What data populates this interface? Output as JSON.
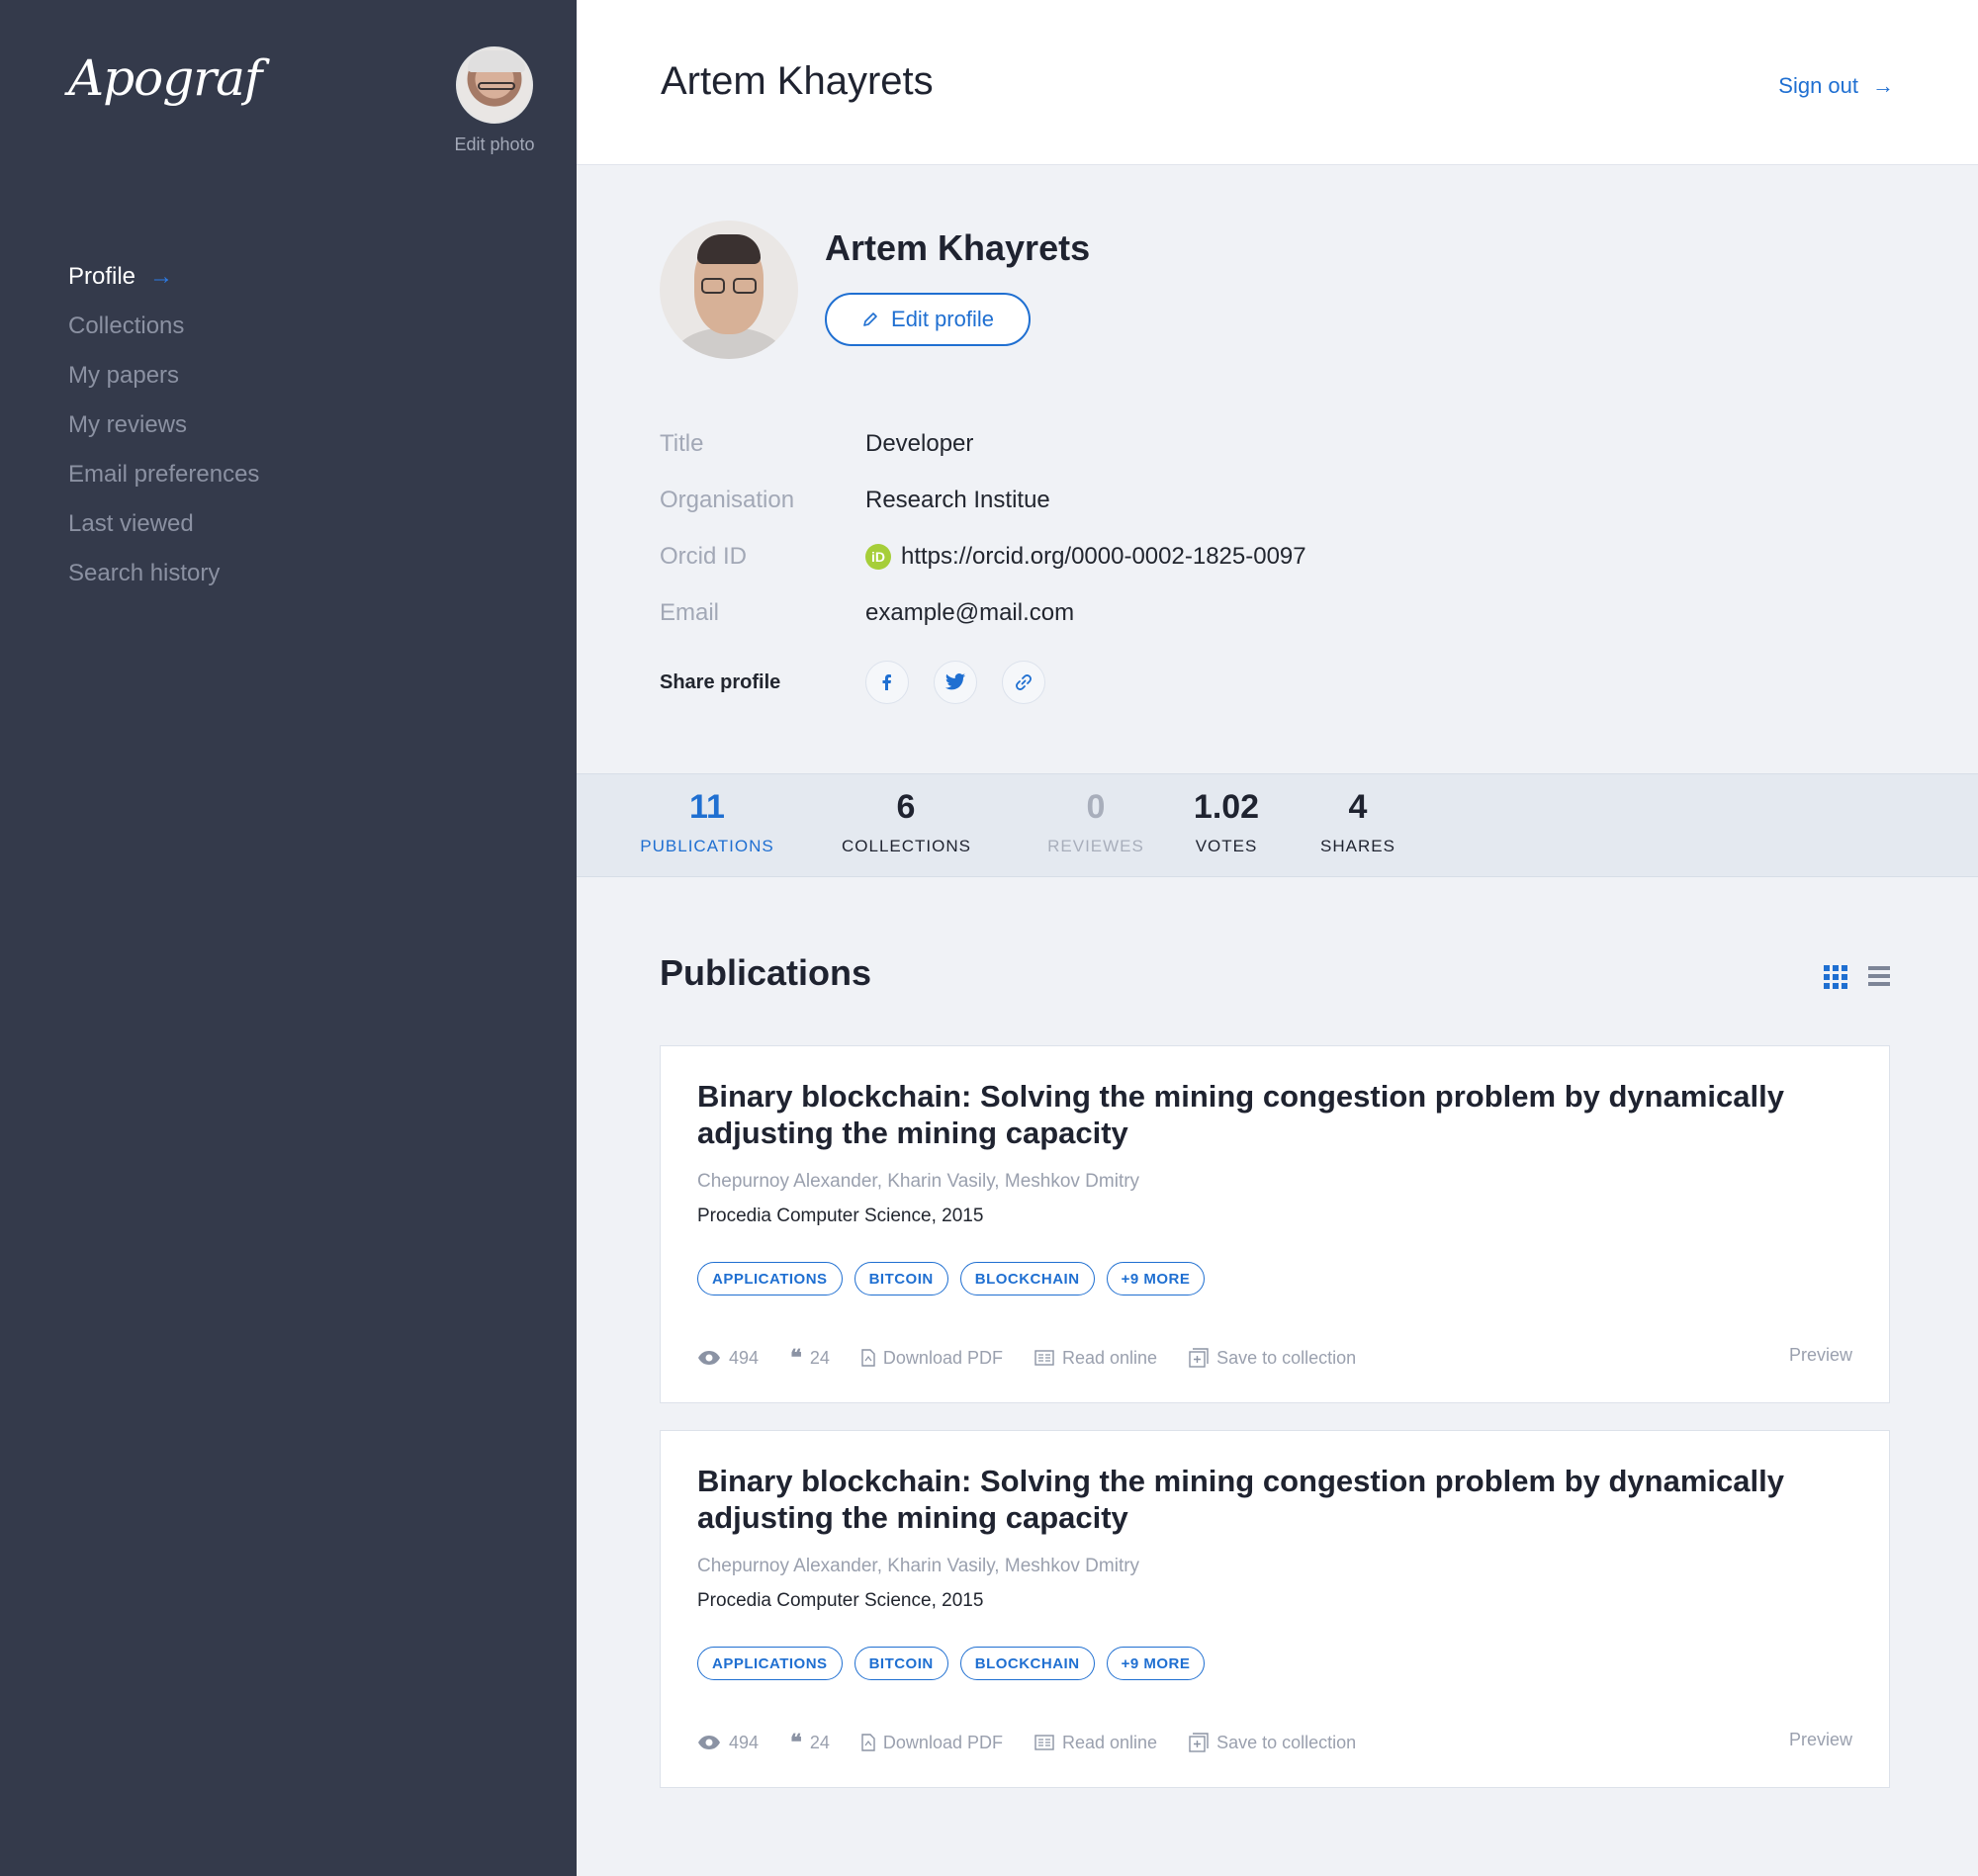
{
  "sidebar": {
    "logo": "Apograf",
    "edit_photo": "Edit photo",
    "nav": [
      {
        "label": "Profile"
      },
      {
        "label": "Collections"
      },
      {
        "label": "My papers"
      },
      {
        "label": "My reviews"
      },
      {
        "label": "Email preferences"
      },
      {
        "label": "Last viewed"
      },
      {
        "label": "Search history"
      }
    ],
    "active_arrow": "→"
  },
  "header": {
    "title": "Artem Khayrets",
    "signout": "Sign out",
    "signout_arrow": "→"
  },
  "profile": {
    "name": "Artem Khayrets",
    "edit_label": "Edit profile",
    "fields": [
      {
        "label": "Title",
        "value": "Developer"
      },
      {
        "label": "Organisation",
        "value": "Research Institue"
      },
      {
        "label": "Orcid ID",
        "value": "https://orcid.org/0000-0002-1825-0097"
      },
      {
        "label": "Email",
        "value": "example@mail.com"
      }
    ],
    "orcid_badge": "iD",
    "share_label": "Share profile",
    "share_icons": [
      "facebook-icon",
      "twitter-icon",
      "link-icon"
    ]
  },
  "stats": [
    {
      "value": "11",
      "label": "PUBLICATIONS"
    },
    {
      "value": "6",
      "label": "COLLECTIONS"
    },
    {
      "value": "0",
      "label": "REVIEWES"
    },
    {
      "value": "1.02",
      "label": "VOTES"
    },
    {
      "value": "4",
      "label": "SHARES"
    }
  ],
  "publications": {
    "heading": "Publications",
    "view_icons": [
      "grid-view-icon",
      "list-view-icon"
    ],
    "items": [
      {
        "title": "Binary blockchain: Solving the mining congestion problem by dynamically adjusting the mining capacity",
        "authors": "Chepurnoy Alexander, Kharin Vasily, Meshkov Dmitry",
        "journal": "Procedia Computer Science, 2015",
        "tags": [
          "APPLICATIONS",
          "BITCOIN",
          "BLOCKCHAIN",
          "+9 MORE"
        ],
        "views": "494",
        "citations": "24",
        "download": "Download PDF",
        "read": "Read online",
        "save": "Save to collection",
        "preview": "Preview"
      },
      {
        "title": "Binary blockchain: Solving the mining congestion problem by dynamically adjusting the mining capacity",
        "authors": "Chepurnoy Alexander, Kharin Vasily, Meshkov Dmitry",
        "journal": "Procedia Computer Science, 2015",
        "tags": [
          "APPLICATIONS",
          "BITCOIN",
          "BLOCKCHAIN",
          "+9 MORE"
        ],
        "views": "494",
        "citations": "24",
        "download": "Download PDF",
        "read": "Read online",
        "save": "Save to collection",
        "preview": "Preview"
      }
    ]
  },
  "colors": {
    "sidebar_bg": "#343a4b",
    "accent": "#1f6fd1",
    "page_bg": "#f0f2f6",
    "orcid_green": "#a6ce39"
  }
}
